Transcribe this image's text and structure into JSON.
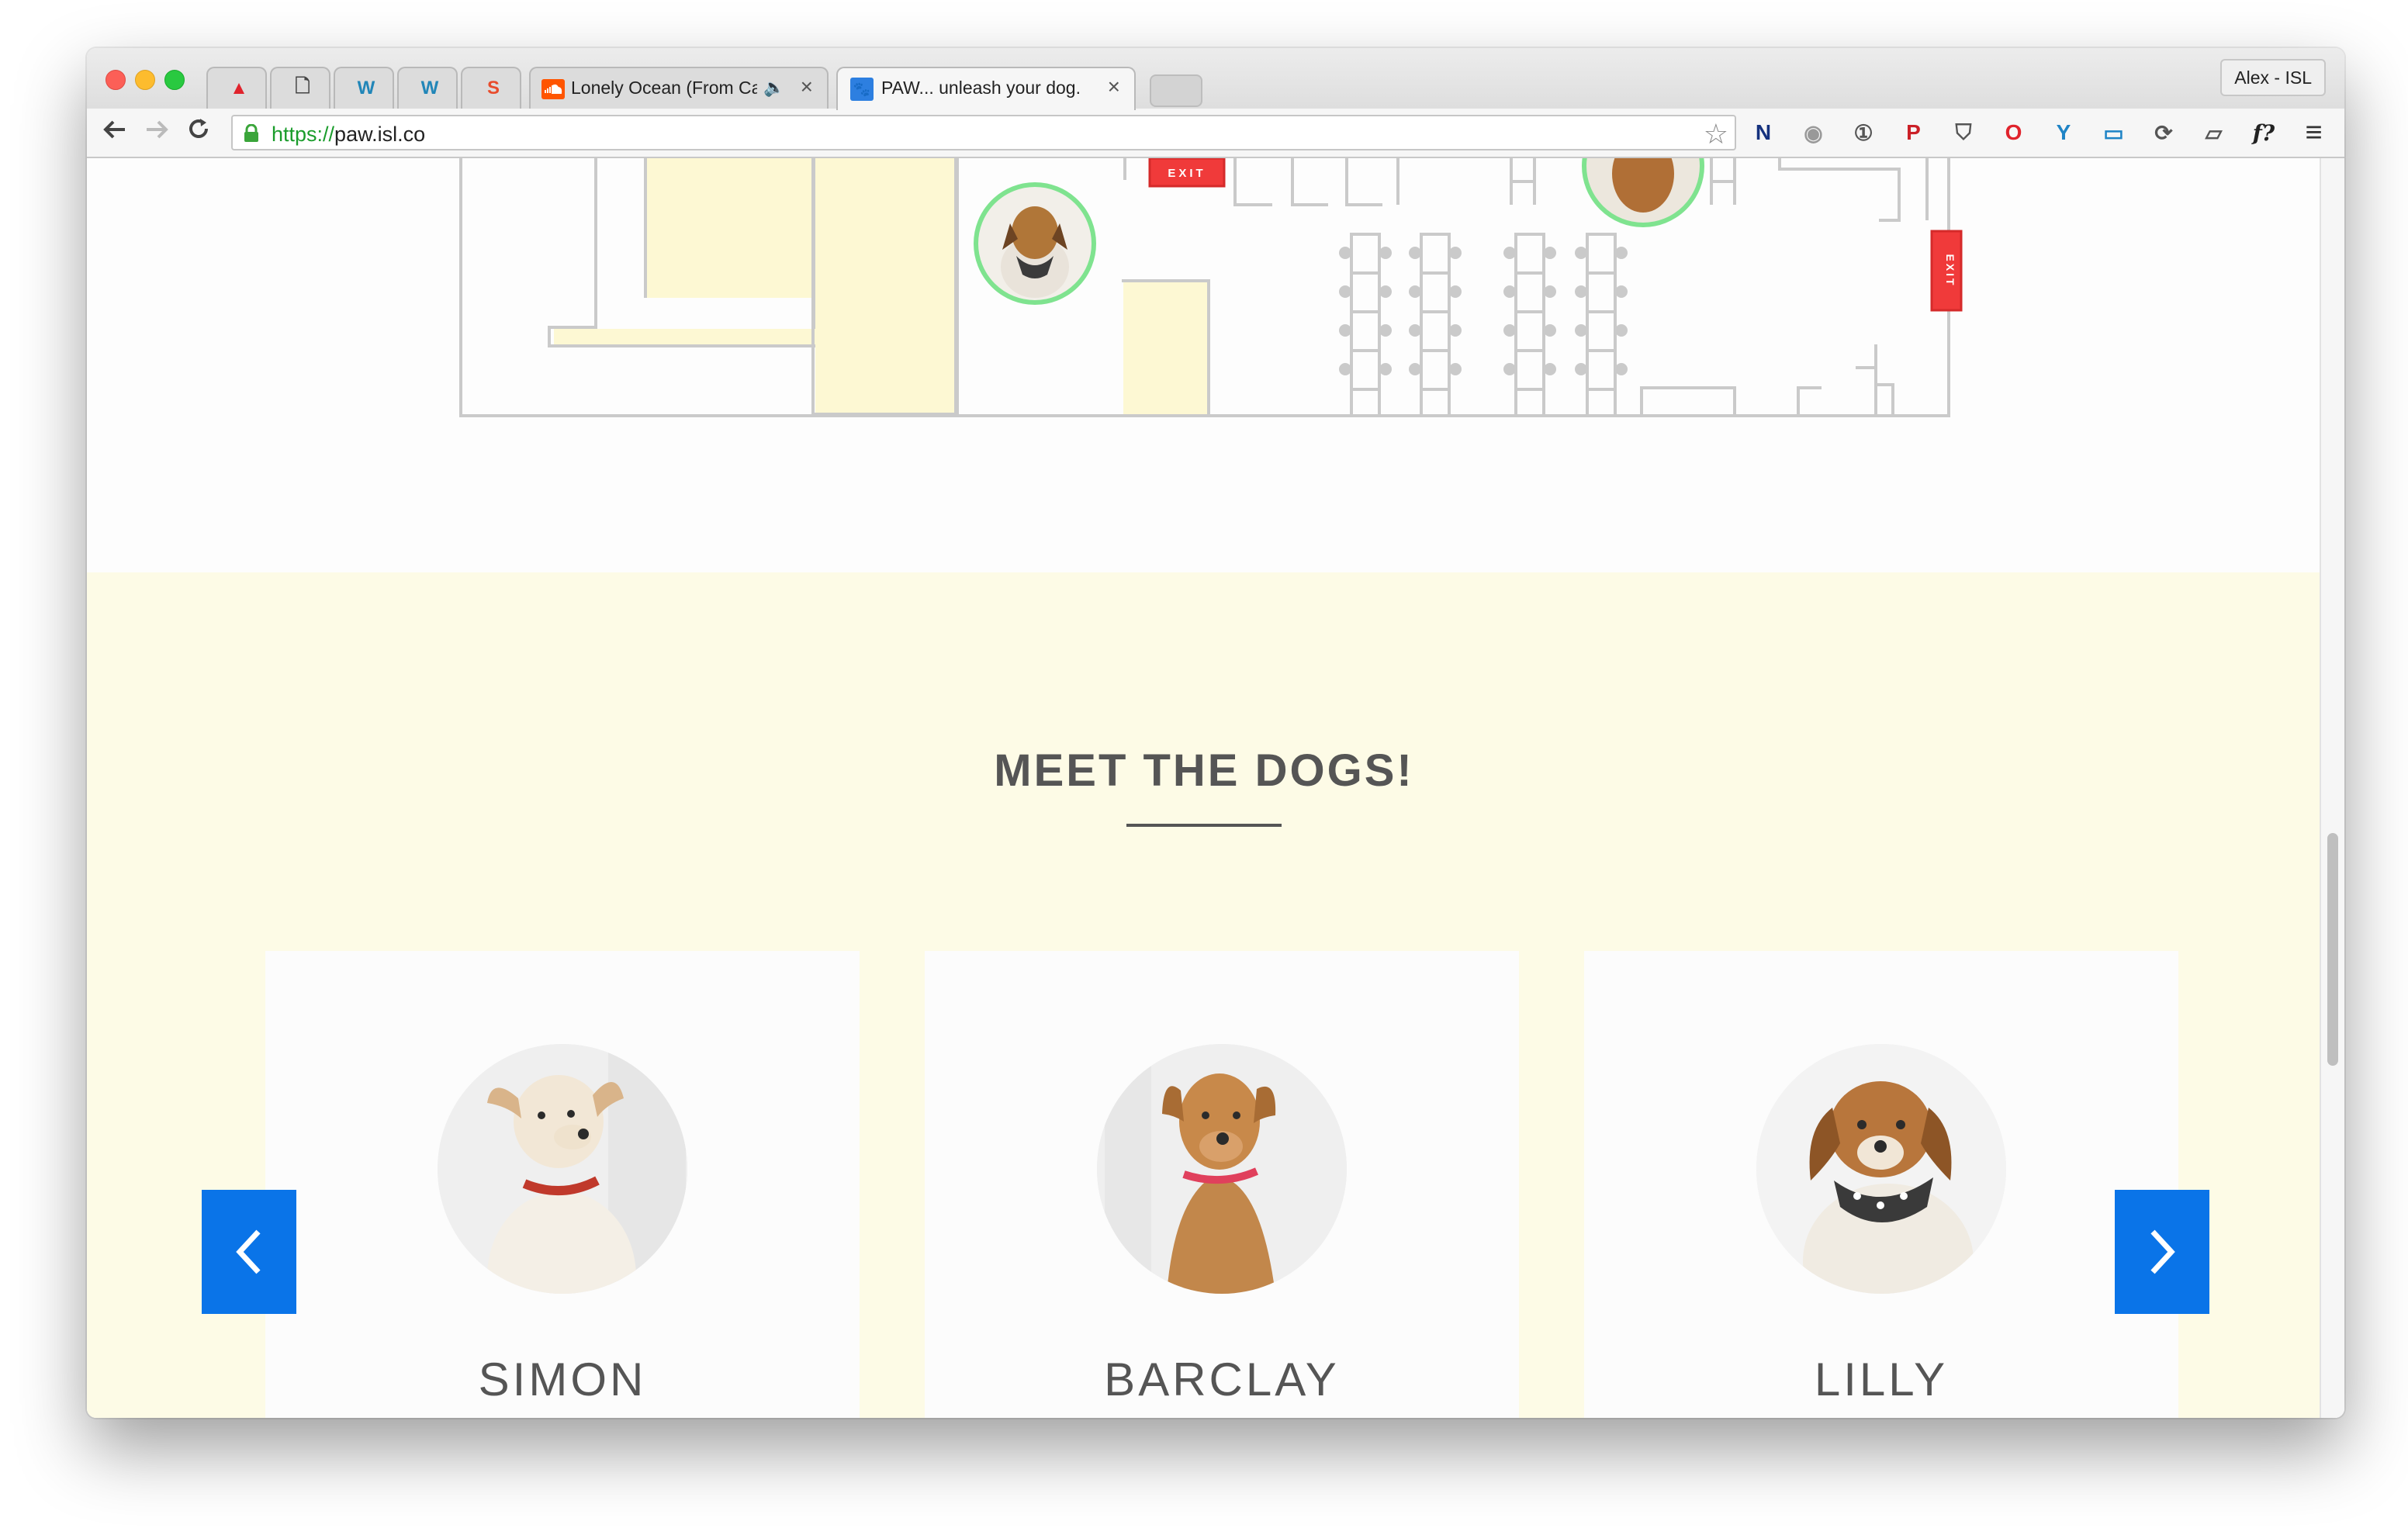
{
  "browser": {
    "tabs": [
      {
        "icon": "acrobat-icon",
        "glyph": "▲",
        "color": "#e0232c"
      },
      {
        "icon": "document-icon",
        "glyph": "🗋",
        "color": "#444"
      },
      {
        "icon": "wordpress-icon",
        "glyph": "W",
        "color": "#2186b8"
      },
      {
        "icon": "wordpress-icon",
        "glyph": "W",
        "color": "#2186b8"
      },
      {
        "icon": "s-app-icon",
        "glyph": "S",
        "color": "#e84c2c"
      }
    ],
    "soundcloud_tab": {
      "title": "Lonely Ocean (From Ca",
      "close": "×"
    },
    "active_tab": {
      "title": "PAW... unleash your dog.",
      "close": "×"
    },
    "profile": "Alex - ISL",
    "url_scheme": "https://",
    "url_host": "paw.isl.co",
    "extensions": [
      {
        "name": "n-extension-icon",
        "glyph": "N",
        "color": "#15317e"
      },
      {
        "name": "camera-icon",
        "glyph": "◉",
        "color": "#999"
      },
      {
        "name": "onepassword-icon",
        "glyph": "①",
        "color": "#555"
      },
      {
        "name": "pinterest-icon",
        "glyph": "P",
        "color": "#cb2027"
      },
      {
        "name": "pocket-icon",
        "glyph": "⛉",
        "color": "#555"
      },
      {
        "name": "opera-icon",
        "glyph": "O",
        "color": "#e0232c"
      },
      {
        "name": "vimeo-icon",
        "glyph": "Y",
        "color": "#1f84c6"
      },
      {
        "name": "screenshot-icon",
        "glyph": "▭",
        "color": "#1f84c6"
      },
      {
        "name": "sync-icon",
        "glyph": "⟳",
        "color": "#555"
      },
      {
        "name": "cast-icon",
        "glyph": "▱",
        "color": "#555"
      },
      {
        "name": "whatfont-icon",
        "glyph": "f?",
        "color": "#222"
      },
      {
        "name": "menu-icon",
        "glyph": "≡",
        "color": "#333"
      }
    ]
  },
  "floorplan": {
    "exit_labels": [
      "EXIT",
      "EXIT"
    ]
  },
  "section": {
    "title": "MEET THE DOGS!"
  },
  "dogs": [
    {
      "name": "SIMON"
    },
    {
      "name": "BARCLAY"
    },
    {
      "name": "LILLY"
    }
  ],
  "colors": {
    "accent": "#0a74e8",
    "section_bg": "#fdfbe6",
    "room_fill": "#fdf8d3",
    "exit_red": "#f03a3a",
    "marker_ring": "#7fe38f"
  }
}
